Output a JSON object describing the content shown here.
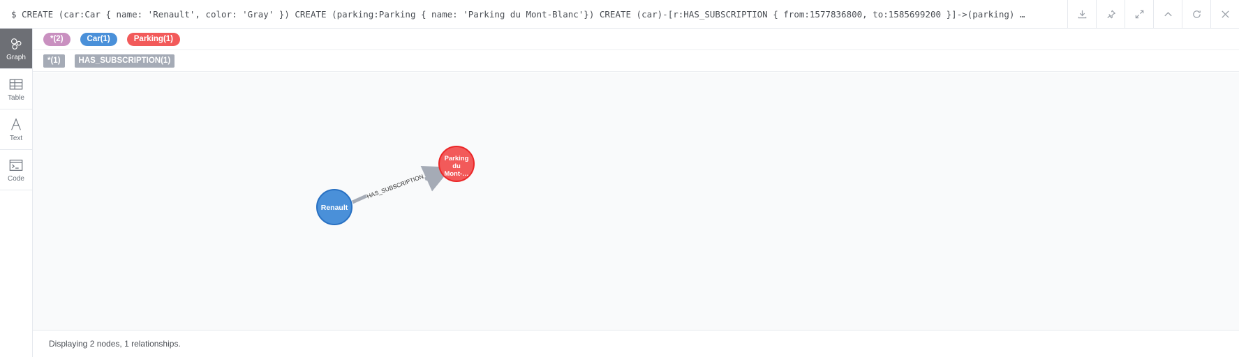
{
  "query": {
    "text": "$ CREATE (car:Car { name: 'Renault', color: 'Gray' }) CREATE (parking:Parking { name: 'Parking du Mont-Blanc'}) CREATE (car)-[r:HAS_SUBSCRIPTION { from:1577836800, to:1585699200 }]->(parking) …"
  },
  "actions": [
    {
      "icon": "download-icon"
    },
    {
      "icon": "pin-icon"
    },
    {
      "icon": "expand-icon"
    },
    {
      "icon": "collapse-icon"
    },
    {
      "icon": "refresh-icon"
    },
    {
      "icon": "close-icon"
    }
  ],
  "sidebar": {
    "items": [
      {
        "label": "Graph",
        "icon": "graph-icon",
        "active": true
      },
      {
        "label": "Table",
        "icon": "table-icon"
      },
      {
        "label": "Text",
        "icon": "text-icon"
      },
      {
        "label": "Code",
        "icon": "code-icon"
      }
    ]
  },
  "legend": {
    "nodes": [
      {
        "label": "*(2)",
        "color": "#c990c0"
      },
      {
        "label": "Car(1)",
        "color": "#4a90d9"
      },
      {
        "label": "Parking(1)",
        "color": "#f25a5a"
      }
    ],
    "relationships": [
      {
        "label": "*(1)"
      },
      {
        "label": "HAS_SUBSCRIPTION(1)"
      }
    ]
  },
  "graph": {
    "nodes": [
      {
        "id": "car",
        "label": "Renault",
        "color": "#4a90d9",
        "stroke": "#2870c2"
      },
      {
        "id": "parking",
        "label_lines": [
          "Parking",
          "du",
          "Mont-…"
        ],
        "color": "#f25a5a",
        "stroke": "#eb2728"
      }
    ],
    "relationship": {
      "label": "HAS_SUBSCRIPTION",
      "color": "#a5abb6"
    }
  },
  "status": {
    "text": "Displaying 2 nodes, 1 relationships."
  }
}
